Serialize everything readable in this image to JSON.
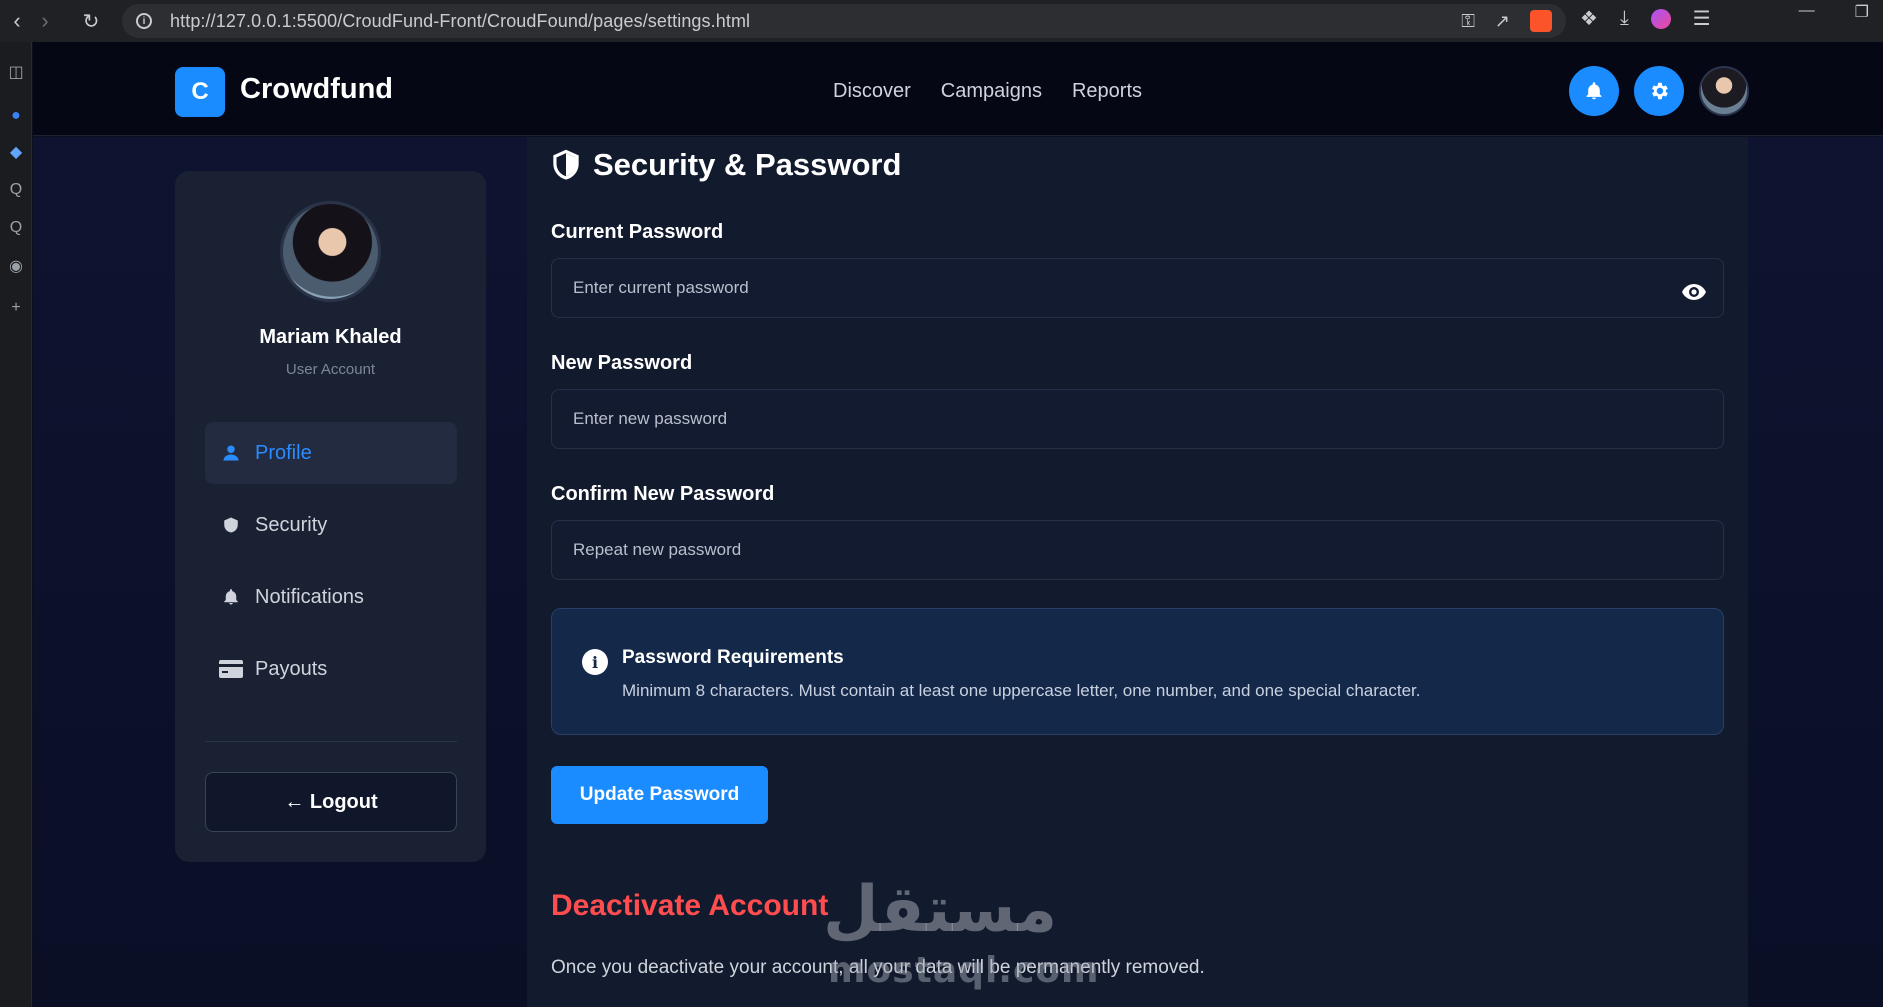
{
  "browser": {
    "url": "http://127.0.0.1:5500/CroudFund-Front/CroudFound/pages/settings.html"
  },
  "brand": {
    "logo_letter": "C",
    "name": "Crowdfund",
    "accent_color": "#1a8cff"
  },
  "nav": {
    "links": [
      "Discover",
      "Campaigns",
      "Reports"
    ]
  },
  "user": {
    "name": "Mariam Khaled",
    "role": "User Account"
  },
  "sidebar": {
    "items": [
      {
        "label": "Profile",
        "icon": "user-icon",
        "active": true
      },
      {
        "label": "Security",
        "icon": "shield-icon",
        "active": false
      },
      {
        "label": "Notifications",
        "icon": "bell-icon",
        "active": false
      },
      {
        "label": "Payouts",
        "icon": "credit-card-icon",
        "active": false
      }
    ],
    "logout_label": "← Logout"
  },
  "security": {
    "title": "Security & Password",
    "current": {
      "label": "Current Password",
      "placeholder": "Enter current password"
    },
    "new": {
      "label": "New Password",
      "placeholder": "Enter new password"
    },
    "confirm": {
      "label": "Confirm New Password",
      "placeholder": "Repeat new password"
    },
    "requirements": {
      "title": "Password Requirements",
      "text": "Minimum 8 characters. Must contain at least one uppercase letter, one number, and one special character."
    },
    "update_label": "Update Password"
  },
  "deactivate": {
    "title": "Deactivate Account",
    "text": "Once you deactivate your account, all your data will be permanently removed.",
    "color": "#ff4d4f"
  },
  "watermark": {
    "arabic": "مستقل",
    "latin": "mostaql.com"
  }
}
